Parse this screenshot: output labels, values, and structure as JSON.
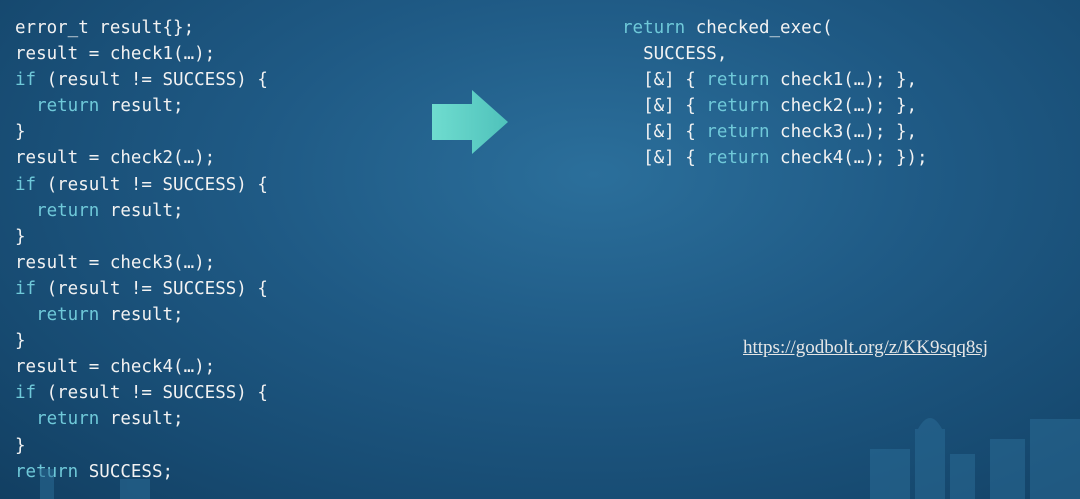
{
  "left_code": [
    [
      {
        "t": "error_t result{};",
        "k": 0
      }
    ],
    [
      {
        "t": "result = check1(…);",
        "k": 0
      }
    ],
    [
      {
        "t": "if",
        "k": 1
      },
      {
        "t": " (result != SUCCESS) {",
        "k": 0
      }
    ],
    [
      {
        "t": "  ",
        "k": 0
      },
      {
        "t": "return",
        "k": 1
      },
      {
        "t": " result;",
        "k": 0
      }
    ],
    [
      {
        "t": "}",
        "k": 0
      }
    ],
    [
      {
        "t": "result = check2(…);",
        "k": 0
      }
    ],
    [
      {
        "t": "if",
        "k": 1
      },
      {
        "t": " (result != SUCCESS) {",
        "k": 0
      }
    ],
    [
      {
        "t": "  ",
        "k": 0
      },
      {
        "t": "return",
        "k": 1
      },
      {
        "t": " result;",
        "k": 0
      }
    ],
    [
      {
        "t": "}",
        "k": 0
      }
    ],
    [
      {
        "t": "result = check3(…);",
        "k": 0
      }
    ],
    [
      {
        "t": "if",
        "k": 1
      },
      {
        "t": " (result != SUCCESS) {",
        "k": 0
      }
    ],
    [
      {
        "t": "  ",
        "k": 0
      },
      {
        "t": "return",
        "k": 1
      },
      {
        "t": " result;",
        "k": 0
      }
    ],
    [
      {
        "t": "}",
        "k": 0
      }
    ],
    [
      {
        "t": "result = check4(…);",
        "k": 0
      }
    ],
    [
      {
        "t": "if",
        "k": 1
      },
      {
        "t": " (result != SUCCESS) {",
        "k": 0
      }
    ],
    [
      {
        "t": "  ",
        "k": 0
      },
      {
        "t": "return",
        "k": 1
      },
      {
        "t": " result;",
        "k": 0
      }
    ],
    [
      {
        "t": "}",
        "k": 0
      }
    ],
    [
      {
        "t": "return",
        "k": 1
      },
      {
        "t": " SUCCESS;",
        "k": 0
      }
    ]
  ],
  "right_code": [
    [
      {
        "t": "return",
        "k": 1
      },
      {
        "t": " checked_exec(",
        "k": 0
      }
    ],
    [
      {
        "t": "  SUCCESS,",
        "k": 0
      }
    ],
    [
      {
        "t": "  [&] { ",
        "k": 0
      },
      {
        "t": "return",
        "k": 1
      },
      {
        "t": " check1(…); },",
        "k": 0
      }
    ],
    [
      {
        "t": "  [&] { ",
        "k": 0
      },
      {
        "t": "return",
        "k": 1
      },
      {
        "t": " check2(…); },",
        "k": 0
      }
    ],
    [
      {
        "t": "  [&] { ",
        "k": 0
      },
      {
        "t": "return",
        "k": 1
      },
      {
        "t": " check3(…); },",
        "k": 0
      }
    ],
    [
      {
        "t": "  [&] { ",
        "k": 0
      },
      {
        "t": "return",
        "k": 1
      },
      {
        "t": " check4(…); });",
        "k": 0
      }
    ]
  ],
  "link_text": "https://godbolt.org/z/KK9sqq8sj",
  "colors": {
    "code_text": "#f2f2f2",
    "keyword": "#6fc9d9",
    "arrow": "#62d1c6",
    "background": "#1f5a85"
  },
  "icons": {
    "arrow": "right-arrow-icon"
  }
}
